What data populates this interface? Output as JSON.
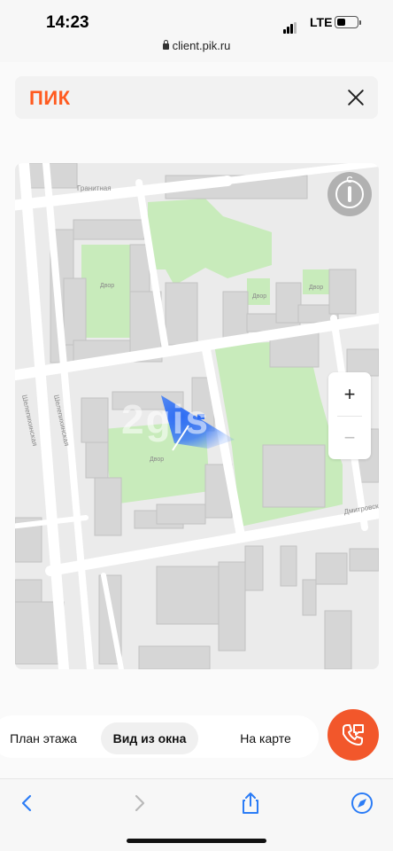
{
  "status_bar": {
    "time": "14:23",
    "network": "LTE",
    "url": "client.pik.ru"
  },
  "header": {
    "logo": "ПИК",
    "close_icon": "close-icon"
  },
  "map": {
    "compass_label": "С",
    "zoom_in_label": "+",
    "zoom_out_label": "−",
    "watermark": "2gis",
    "street_labels": [
      "Гранитная",
      "Шелепихинская",
      "Шелепихинская",
      "Дмитровск"
    ],
    "parks": [
      "Двор",
      "Двор",
      "Двор",
      "Двор"
    ],
    "colors": {
      "background": "#ebebeb",
      "park": "#c8ebbb",
      "building": "#d6d6d6",
      "road": "#ffffff",
      "view_cone": "#2b6bf3"
    }
  },
  "tabs": [
    {
      "label": "План этажа",
      "active": false
    },
    {
      "label": "Вид из окна",
      "active": true
    },
    {
      "label": "На карте",
      "active": false
    }
  ],
  "fab": {
    "icon": "phone-call-icon",
    "color": "#f2572b"
  },
  "toolbar": {
    "icons": [
      "back-icon",
      "forward-icon",
      "share-icon",
      "compass-safari-icon"
    ]
  }
}
